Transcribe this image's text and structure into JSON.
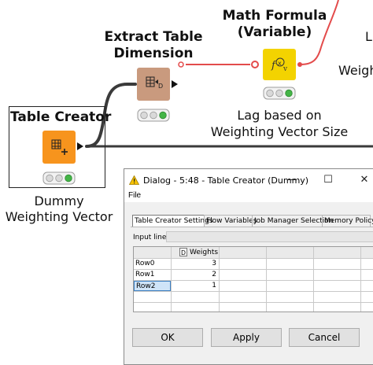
{
  "workflow": {
    "nodes": {
      "table_creator": {
        "title": "Table Creator",
        "caption_line1": "Dummy",
        "caption_line2": "Weighting Vector"
      },
      "extract_dimension": {
        "title_line1": "Extract Table",
        "title_line2": "Dimension"
      },
      "math_formula": {
        "title_line1": "Math Formula",
        "title_line2": "(Variable)",
        "caption_line1": "Lag based on",
        "caption_line2": "Weighting Vector Size"
      }
    },
    "partial_texts": {
      "right_top": "L",
      "right_mid": "Weigh"
    },
    "colors": {
      "table_creator": "#f7941d",
      "extract": "#c99a7e",
      "math": "#f3d300",
      "flow_var_line": "#e34b4b",
      "status_green": "#44b547",
      "status_gray": "#d9d9d9"
    }
  },
  "dialog": {
    "title": "Dialog - 5:48 - Table Creator (Dummy)",
    "window_buttons": {
      "minimize": "—",
      "maximize": "☐",
      "close": "✕"
    },
    "menu": {
      "file": "File"
    },
    "tabs": [
      {
        "label": "Table Creator Settings",
        "active": true
      },
      {
        "label": "Flow Variables",
        "active": false
      },
      {
        "label": "Job Manager Selection",
        "active": false
      },
      {
        "label": "Memory Policy",
        "active": false
      }
    ],
    "input_line_label": "Input line:",
    "table": {
      "column_badge": "D",
      "column_name": "Weights",
      "rows": [
        {
          "name": "Row0",
          "value": "3",
          "selected": false
        },
        {
          "name": "Row1",
          "value": "2",
          "selected": false
        },
        {
          "name": "Row2",
          "value": "1",
          "selected": true
        }
      ]
    },
    "buttons": {
      "ok": "OK",
      "apply": "Apply",
      "cancel": "Cancel"
    }
  }
}
